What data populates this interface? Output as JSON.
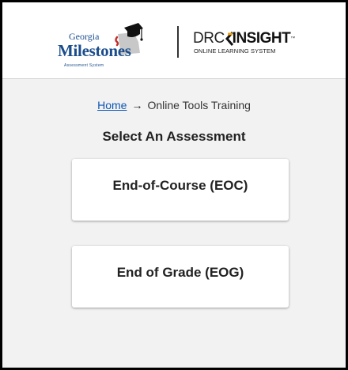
{
  "header": {
    "georgia_logo": {
      "line1": "Georgia",
      "line2": "Milestones",
      "line3": "Assessment System"
    },
    "drc_logo": {
      "brand_prefix": "DRC",
      "brand_main": "INSIGHT",
      "trademark": "™",
      "subtitle": "ONLINE LEARNING SYSTEM"
    }
  },
  "breadcrumb": {
    "home_label": "Home",
    "separator": "→",
    "current": "Online Tools Training"
  },
  "main": {
    "title": "Select An Assessment",
    "assessments": [
      {
        "label": "End-of-Course (EOC)"
      },
      {
        "label": "End of Grade (EOG)"
      }
    ]
  },
  "colors": {
    "link": "#0c55b5",
    "logo_blue": "#1b4d8c",
    "page_bg": "#f2f2f2"
  }
}
